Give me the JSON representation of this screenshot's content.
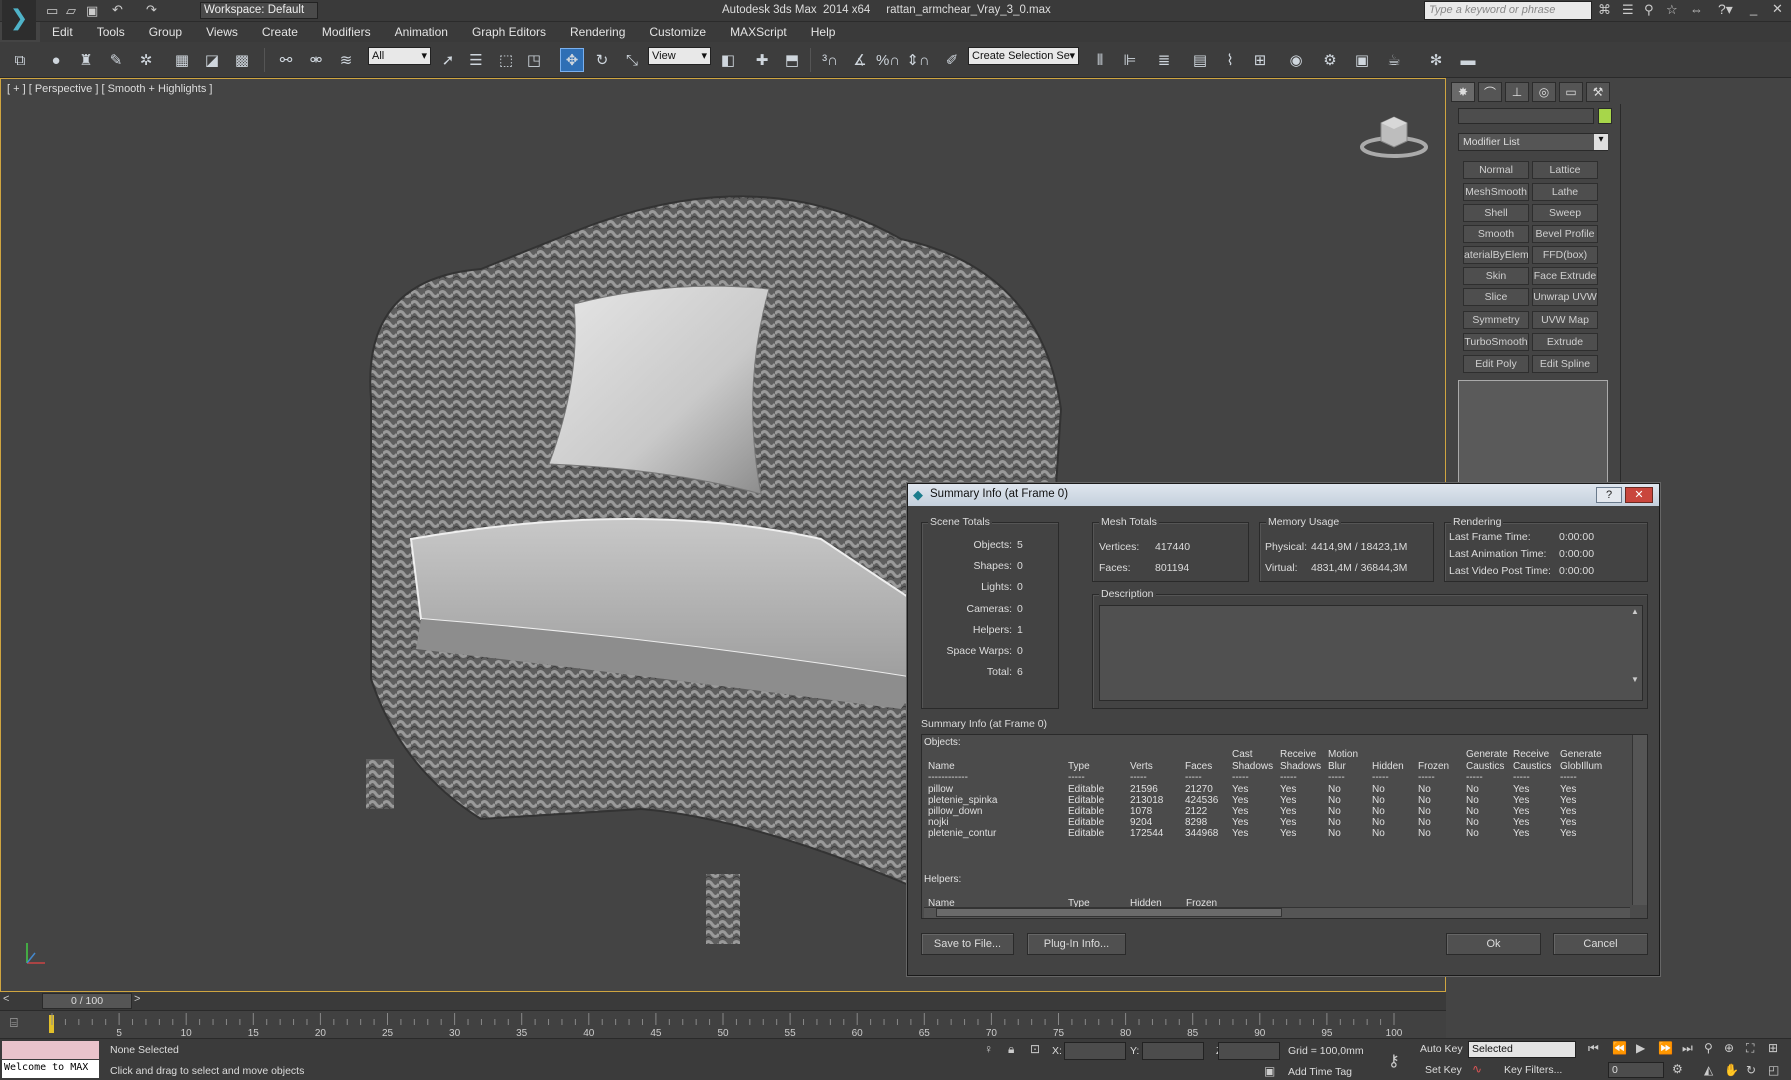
{
  "app": {
    "title": "Autodesk 3ds Max  2014 x64     rattan_armchear_Vray_3_0.max",
    "workspace": "Workspace: Default",
    "search_placeholder": "Type a keyword or phrase"
  },
  "menu": [
    "Edit",
    "Tools",
    "Group",
    "Views",
    "Create",
    "Modifiers",
    "Animation",
    "Graph Editors",
    "Rendering",
    "Customize",
    "MAXScript",
    "Help"
  ],
  "toolbar": {
    "filter": "All",
    "view_dropdown": "View",
    "selection_set": "Create Selection Se"
  },
  "viewport": {
    "label": "[ + ] [ Perspective ] [ Smooth + Highlights ]"
  },
  "command_panel": {
    "modifier_list": "Modifier List",
    "modifiers": [
      "Normal",
      "Lattice",
      "MeshSmooth",
      "Lathe",
      "Shell",
      "Sweep",
      "Smooth",
      "Bevel Profile",
      "aterialByEleme",
      "FFD(box)",
      "Skin",
      "Face Extrude",
      "Slice",
      "Unwrap UVW",
      "Symmetry",
      "UVW Map",
      "TurboSmooth",
      "Extrude",
      "Edit Poly",
      "Edit Spline"
    ]
  },
  "dialog": {
    "title": "Summary Info (at Frame 0)",
    "scene_totals": {
      "label": "Scene Totals",
      "rows": [
        {
          "k": "Objects:",
          "v": "5"
        },
        {
          "k": "Shapes:",
          "v": "0"
        },
        {
          "k": "Lights:",
          "v": "0"
        },
        {
          "k": "Cameras:",
          "v": "0"
        },
        {
          "k": "Helpers:",
          "v": "1"
        },
        {
          "k": "Space Warps:",
          "v": "0"
        },
        {
          "k": "Total:",
          "v": "6"
        }
      ]
    },
    "mesh_totals": {
      "label": "Mesh Totals",
      "vertices_label": "Vertices:",
      "vertices": "417440",
      "faces_label": "Faces:",
      "faces": "801194"
    },
    "memory": {
      "label": "Memory Usage",
      "physical_label": "Physical:",
      "physical": "4414,9M / 18423,1M",
      "virtual_label": "Virtual:",
      "virtual": "4831,4M / 36844,3M"
    },
    "rendering": {
      "label": "Rendering",
      "rows": [
        {
          "k": "Last Frame Time:",
          "v": "0:00:00"
        },
        {
          "k": "Last Animation Time:",
          "v": "0:00:00"
        },
        {
          "k": "Last Video Post Time:",
          "v": "0:00:00"
        }
      ]
    },
    "description_label": "Description",
    "summary_label": "Summary Info (at Frame 0)",
    "objects_heading": "Objects:",
    "columns": [
      "Name",
      "Type",
      "Verts",
      "Faces",
      "Cast\nShadows",
      "Receive\nShadows",
      "Motion\nBlur",
      "Hidden",
      "Frozen",
      "Generate\nCaustics",
      "Receive\nCaustics",
      "Generate\nGlobIllum"
    ],
    "objects": [
      [
        "pillow",
        "Editable",
        "21596",
        "21270",
        "Yes",
        "Yes",
        "No",
        "No",
        "No",
        "No",
        "Yes",
        "Yes"
      ],
      [
        "pletenie_spinka",
        "Editable",
        "213018",
        "424536",
        "Yes",
        "Yes",
        "No",
        "No",
        "No",
        "No",
        "Yes",
        "Yes"
      ],
      [
        "pillow_down",
        "Editable",
        "1078",
        "2122",
        "Yes",
        "Yes",
        "No",
        "No",
        "No",
        "No",
        "Yes",
        "Yes"
      ],
      [
        "nojki",
        "Editable",
        "9204",
        "8298",
        "Yes",
        "Yes",
        "No",
        "No",
        "No",
        "No",
        "Yes",
        "Yes"
      ],
      [
        "pletenie_contur",
        "Editable",
        "172544",
        "344968",
        "Yes",
        "Yes",
        "No",
        "No",
        "No",
        "No",
        "Yes",
        "Yes"
      ]
    ],
    "helpers_heading": "Helpers:",
    "helper_columns": [
      "Name",
      "Type",
      "Hidden",
      "Frozen"
    ],
    "buttons": {
      "save": "Save to File...",
      "plugin": "Plug-In Info...",
      "ok": "Ok",
      "cancel": "Cancel"
    }
  },
  "timeline": {
    "frame": "0 / 100",
    "ticks": [
      "0",
      "5",
      "10",
      "15",
      "20",
      "25",
      "30",
      "35",
      "40",
      "45",
      "50",
      "55",
      "60",
      "65",
      "70",
      "75",
      "80",
      "85",
      "90",
      "95",
      "100"
    ]
  },
  "status": {
    "maxscript": "Welcome to MAX",
    "selection": "None Selected",
    "prompt": "Click and drag to select and move objects",
    "x_label": "X:",
    "y_label": "Y:",
    "z_label": "Z:",
    "grid": "Grid = 100,0mm",
    "add_time_tag": "Add Time Tag",
    "auto_key": "Auto Key",
    "set_key": "Set Key",
    "key_mode": "Selected",
    "key_filters": "Key Filters...",
    "current_frame": "0"
  },
  "colors": {
    "accent": "#2f6fb5",
    "viewport_border": "#cfa540",
    "bg": "#444444"
  }
}
